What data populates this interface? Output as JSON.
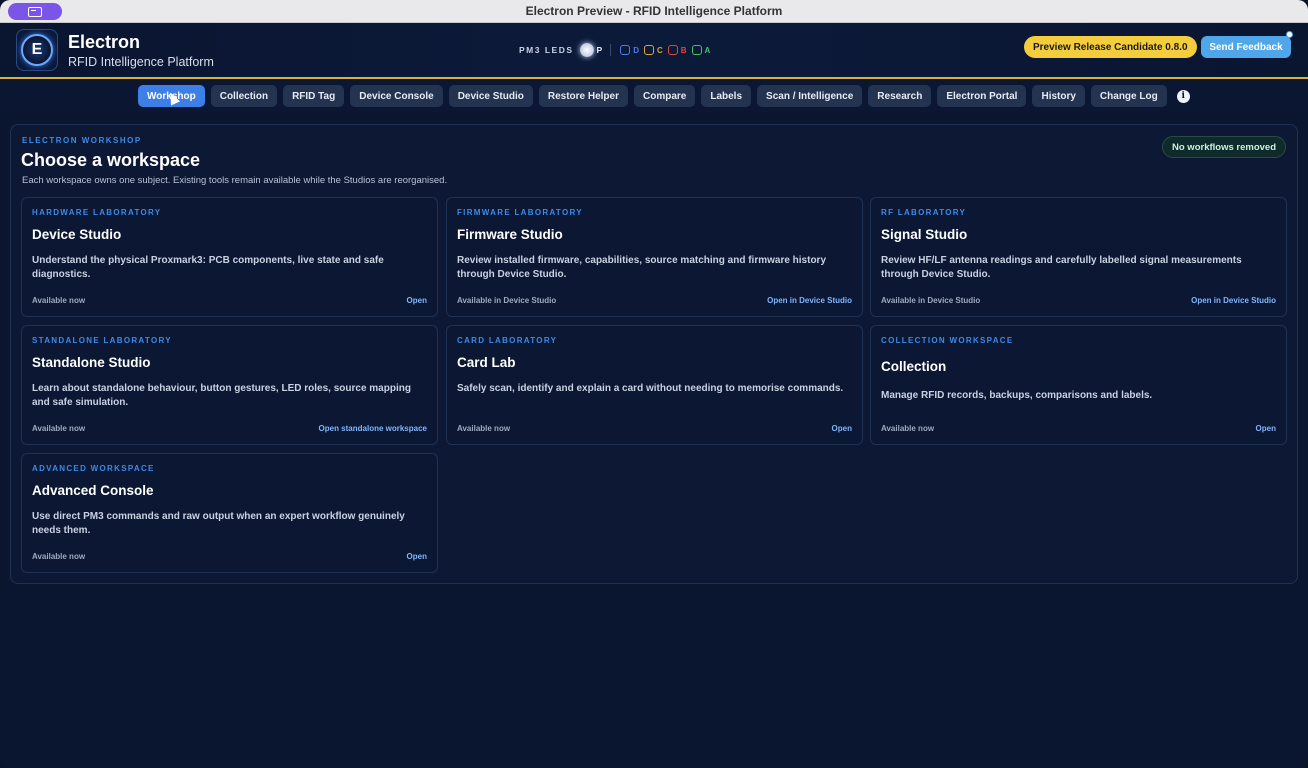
{
  "window": {
    "title": "Electron Preview - RFID Intelligence Platform"
  },
  "header": {
    "app_name": "Electron",
    "app_sub": "RFID Intelligence Platform",
    "logo_letter": "E",
    "leds_label": "PM3 LEDS",
    "led_p": "P",
    "leds": [
      {
        "label": "D",
        "color": "#4a7ff0"
      },
      {
        "label": "C",
        "color": "#e0a43a"
      },
      {
        "label": "B",
        "color": "#e04646"
      },
      {
        "label": "A",
        "color": "#44c06b"
      }
    ],
    "preview_label": "Preview Release Candidate 0.8.0",
    "feedback_label": "Send Feedback"
  },
  "nav": {
    "tabs": [
      {
        "label": "Workshop",
        "active": true
      },
      {
        "label": "Collection"
      },
      {
        "label": "RFID Tag"
      },
      {
        "label": "Device Console"
      },
      {
        "label": "Device Studio"
      },
      {
        "label": "Restore Helper"
      },
      {
        "label": "Compare"
      },
      {
        "label": "Labels"
      },
      {
        "label": "Scan / Intelligence"
      },
      {
        "label": "Research"
      },
      {
        "label": "Electron Portal"
      },
      {
        "label": "History"
      },
      {
        "label": "Change Log"
      }
    ],
    "info_glyph": "i"
  },
  "workshop": {
    "eyebrow": "ELECTRON WORKSHOP",
    "title": "Choose a workspace",
    "description": "Each workspace owns one subject. Existing tools remain available while the Studios are reorganised.",
    "badge": "No workflows removed",
    "cards": [
      {
        "eyebrow": "HARDWARE LABORATORY",
        "title": "Device Studio",
        "desc": "Understand the physical Proxmark3: PCB components, live state and safe diagnostics.",
        "status": "Available now",
        "action": "Open"
      },
      {
        "eyebrow": "FIRMWARE LABORATORY",
        "title": "Firmware Studio",
        "desc": "Review installed firmware, capabilities, source matching and firmware history through Device Studio.",
        "status": "Available in Device Studio",
        "action": "Open in Device Studio"
      },
      {
        "eyebrow": "RF LABORATORY",
        "title": "Signal Studio",
        "desc": "Review HF/LF antenna readings and carefully labelled signal measurements through Device Studio.",
        "status": "Available in Device Studio",
        "action": "Open in Device Studio"
      },
      {
        "eyebrow": "STANDALONE LABORATORY",
        "title": "Standalone Studio",
        "desc": "Learn about standalone behaviour, button gestures, LED roles, source mapping and safe simulation.",
        "status": "Available now",
        "action": "Open standalone workspace"
      },
      {
        "eyebrow": "CARD LABORATORY",
        "title": "Card Lab",
        "desc": "Safely scan, identify and explain a card without needing to memorise commands.",
        "status": "Available now",
        "action": "Open"
      },
      {
        "eyebrow": "COLLECTION WORKSPACE",
        "title": "Collection",
        "desc": "Manage RFID records, backups, comparisons and labels.",
        "status": "Available now",
        "action": "Open"
      },
      {
        "eyebrow": "ADVANCED WORKSPACE",
        "title": "Advanced Console",
        "desc": "Use direct PM3 commands and raw output when an expert workflow genuinely needs them.",
        "status": "Available now",
        "action": "Open"
      }
    ]
  }
}
